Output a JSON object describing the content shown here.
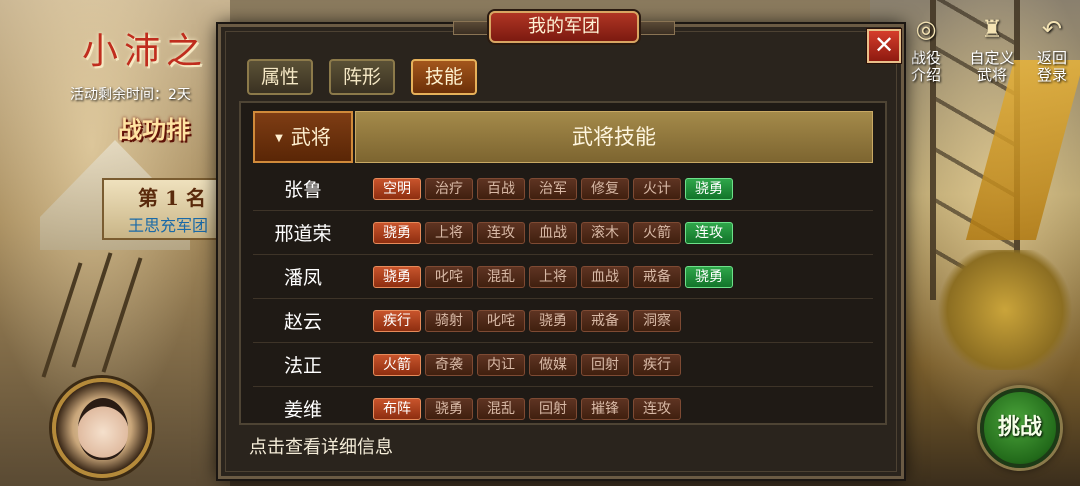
{
  "background": {
    "event_title": "小沛之",
    "event_time": "活动剩余时间：2天",
    "rank_title": "战功排",
    "rank_name": "第 1 名",
    "rank_team": "王思充军团"
  },
  "right_icons": [
    {
      "name": "campaign",
      "label": "战役\n介绍",
      "icon": "seal-icon"
    },
    {
      "name": "custom",
      "label": "自定义\n武将",
      "icon": "general-icon"
    },
    {
      "name": "return",
      "label": "返回\n登录",
      "icon": "return-arrow-icon"
    }
  ],
  "fight_label": "挑战",
  "dialog": {
    "title": "我的军团",
    "close_label": "✕",
    "tabs": [
      {
        "label": "属性",
        "active": false
      },
      {
        "label": "阵形",
        "active": false
      },
      {
        "label": "技能",
        "active": true
      }
    ],
    "head": {
      "general": "武将",
      "skills": "武将技能"
    },
    "rows": [
      {
        "name": "张鲁",
        "skills": [
          {
            "t": "空明",
            "s": "active"
          },
          {
            "t": "治疗",
            "s": "normal"
          },
          {
            "t": "百战",
            "s": "normal"
          },
          {
            "t": "治军",
            "s": "normal"
          },
          {
            "t": "修复",
            "s": "normal"
          },
          {
            "t": "火计",
            "s": "normal"
          },
          {
            "t": "骁勇",
            "s": "special"
          }
        ]
      },
      {
        "name": "邢道荣",
        "skills": [
          {
            "t": "骁勇",
            "s": "active"
          },
          {
            "t": "上将",
            "s": "normal"
          },
          {
            "t": "连攻",
            "s": "normal"
          },
          {
            "t": "血战",
            "s": "normal"
          },
          {
            "t": "滚木",
            "s": "normal"
          },
          {
            "t": "火箭",
            "s": "normal"
          },
          {
            "t": "连攻",
            "s": "special"
          }
        ]
      },
      {
        "name": "潘凤",
        "skills": [
          {
            "t": "骁勇",
            "s": "active"
          },
          {
            "t": "叱咤",
            "s": "normal"
          },
          {
            "t": "混乱",
            "s": "normal"
          },
          {
            "t": "上将",
            "s": "normal"
          },
          {
            "t": "血战",
            "s": "normal"
          },
          {
            "t": "戒备",
            "s": "normal"
          },
          {
            "t": "骁勇",
            "s": "special"
          }
        ]
      },
      {
        "name": "赵云",
        "skills": [
          {
            "t": "疾行",
            "s": "active"
          },
          {
            "t": "骑射",
            "s": "normal"
          },
          {
            "t": "叱咤",
            "s": "normal"
          },
          {
            "t": "骁勇",
            "s": "normal"
          },
          {
            "t": "戒备",
            "s": "normal"
          },
          {
            "t": "洞察",
            "s": "normal"
          }
        ]
      },
      {
        "name": "法正",
        "skills": [
          {
            "t": "火箭",
            "s": "active"
          },
          {
            "t": "奇袭",
            "s": "normal"
          },
          {
            "t": "内讧",
            "s": "normal"
          },
          {
            "t": "做媒",
            "s": "normal"
          },
          {
            "t": "回射",
            "s": "normal"
          },
          {
            "t": "疾行",
            "s": "normal"
          }
        ]
      },
      {
        "name": "姜维",
        "skills": [
          {
            "t": "布阵",
            "s": "active"
          },
          {
            "t": "骁勇",
            "s": "normal"
          },
          {
            "t": "混乱",
            "s": "normal"
          },
          {
            "t": "回射",
            "s": "normal"
          },
          {
            "t": "摧锋",
            "s": "normal"
          },
          {
            "t": "连攻",
            "s": "normal"
          }
        ]
      }
    ],
    "footer_hint": "点击查看详细信息"
  }
}
